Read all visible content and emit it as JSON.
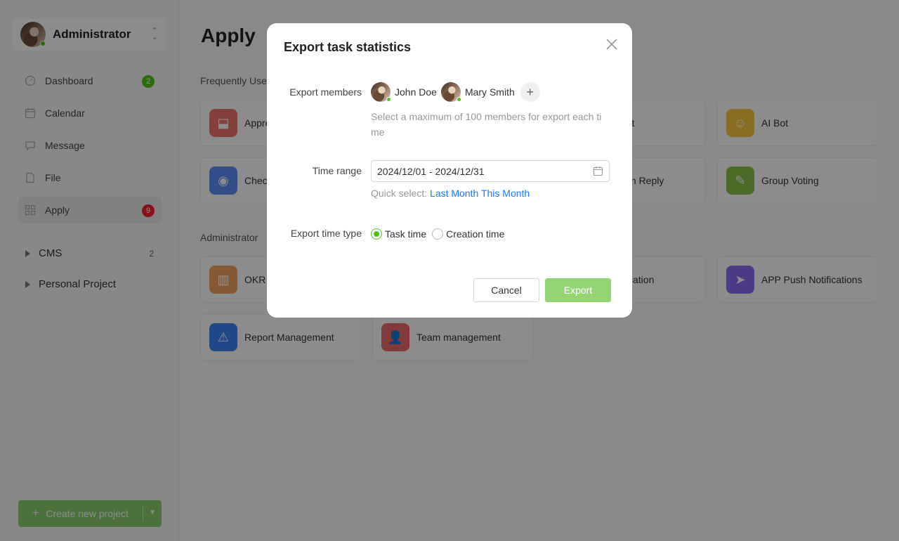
{
  "sidebar": {
    "user": {
      "name": "Administrator"
    },
    "items": [
      {
        "label": "Dashboard",
        "icon": "dashboard-icon",
        "badge": "2",
        "badge_color": "#52c41a"
      },
      {
        "label": "Calendar",
        "icon": "calendar-icon",
        "badge": null
      },
      {
        "label": "Message",
        "icon": "message-icon",
        "badge": null
      },
      {
        "label": "File",
        "icon": "file-icon",
        "badge": null
      },
      {
        "label": "Apply",
        "icon": "apps-icon",
        "badge": "9",
        "badge_color": "#f5222d",
        "active": true
      }
    ],
    "groups": [
      {
        "label": "CMS",
        "count": "2"
      },
      {
        "label": "Personal Project",
        "count": ""
      }
    ],
    "create_button": {
      "label": "Create new project",
      "color": "#87d068"
    }
  },
  "main": {
    "title": "Apply",
    "sections": [
      {
        "label": "Frequently Use"
      },
      {
        "label": "Administrator"
      }
    ],
    "apps": [
      {
        "label": "Appro",
        "icon": "stamp-icon",
        "color": "#f0776e"
      },
      {
        "label": "ort",
        "icon": "report-icon",
        "color": "#5ab4f0"
      },
      {
        "label": "AI Bot",
        "icon": "robot-icon",
        "color": "#f7c641"
      },
      {
        "label": "Chec",
        "icon": "location-icon",
        "color": "#5b8ff9"
      },
      {
        "label": "ain Reply",
        "icon": "reply-icon",
        "color": "#6dc8a9"
      },
      {
        "label": "Group Voting",
        "icon": "vote-icon",
        "color": "#8bc34a"
      },
      {
        "label": "OKR",
        "icon": "okr-chart-icon",
        "color": "#f5a35c"
      },
      {
        "label": "fication",
        "icon": "notification-icon",
        "color": "#f59a5c"
      },
      {
        "label": "APP Push Notifications",
        "icon": "paper-plane-icon",
        "color": "#8a6cf0"
      },
      {
        "label": "Report Management",
        "icon": "warning-icon",
        "color": "#3b82f6"
      },
      {
        "label": "Team management",
        "icon": "team-icon",
        "color": "#ef6b6b"
      }
    ]
  },
  "modal": {
    "title": "Export task statistics",
    "members_label": "Export members",
    "members": [
      {
        "name": "John Doe"
      },
      {
        "name": "Mary Smith"
      }
    ],
    "members_hint": "Select a maximum of 100 members for export each time",
    "time_range_label": "Time range",
    "time_range_value": "2024/12/01 - 2024/12/31",
    "quick_select_label": "Quick select:",
    "quick_last_month": "Last Month",
    "quick_this_month": "This Month",
    "time_type_label": "Export time type",
    "time_type_options": [
      {
        "label": "Task time",
        "selected": true
      },
      {
        "label": "Creation time",
        "selected": false
      }
    ],
    "cancel_label": "Cancel",
    "export_label": "Export",
    "accent_color": "#52c41a",
    "link_color": "#1677ff"
  }
}
